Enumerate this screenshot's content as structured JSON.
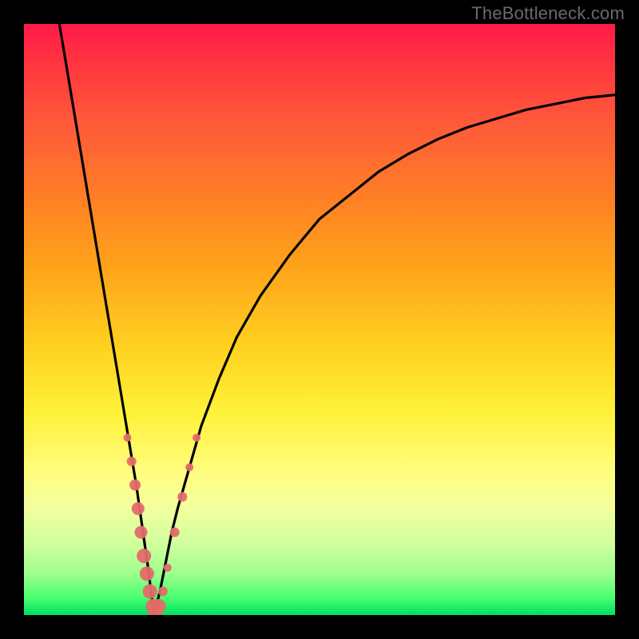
{
  "attribution": "TheBottleneck.com",
  "colors": {
    "frame": "#000000",
    "curve": "#000000",
    "markers": "#e46a6a",
    "gradient_top": "#ff1a4a",
    "gradient_bottom": "#00e060"
  },
  "chart_data": {
    "type": "line",
    "title": "",
    "xlabel": "",
    "ylabel": "",
    "xlim": [
      0,
      100
    ],
    "ylim": [
      0,
      100
    ],
    "grid": false,
    "legend": false,
    "note": "No axis tick labels are rendered; x and y are normalized 0–100. Curve is an absolute-value-like bottleneck function with a sharp minimum near x≈22.",
    "series": [
      {
        "name": "bottleneck-curve",
        "x": [
          6,
          8,
          10,
          12,
          14,
          16,
          18,
          19,
          20,
          21,
          22,
          23,
          24,
          25,
          26,
          28,
          30,
          33,
          36,
          40,
          45,
          50,
          55,
          60,
          65,
          70,
          75,
          80,
          85,
          90,
          95,
          100
        ],
        "y": [
          100,
          88,
          76,
          64,
          52,
          40,
          28,
          22,
          15,
          8,
          0,
          4,
          9,
          14,
          18,
          25,
          32,
          40,
          47,
          54,
          61,
          67,
          71,
          75,
          78,
          80.5,
          82.5,
          84,
          85.5,
          86.5,
          87.5,
          88
        ]
      }
    ],
    "markers": [
      {
        "x": 17.5,
        "y": 30,
        "r": 5
      },
      {
        "x": 18.2,
        "y": 26,
        "r": 6
      },
      {
        "x": 18.8,
        "y": 22,
        "r": 7
      },
      {
        "x": 19.3,
        "y": 18,
        "r": 8
      },
      {
        "x": 19.8,
        "y": 14,
        "r": 8
      },
      {
        "x": 20.3,
        "y": 10,
        "r": 9
      },
      {
        "x": 20.8,
        "y": 7,
        "r": 9
      },
      {
        "x": 21.3,
        "y": 4,
        "r": 9
      },
      {
        "x": 21.8,
        "y": 1.5,
        "r": 9
      },
      {
        "x": 22.2,
        "y": 0.5,
        "r": 9
      },
      {
        "x": 22.8,
        "y": 1.5,
        "r": 9
      },
      {
        "x": 23.5,
        "y": 4,
        "r": 6
      },
      {
        "x": 24.3,
        "y": 8,
        "r": 5
      },
      {
        "x": 25.5,
        "y": 14,
        "r": 6
      },
      {
        "x": 26.8,
        "y": 20,
        "r": 6
      },
      {
        "x": 28.0,
        "y": 25,
        "r": 5
      },
      {
        "x": 29.2,
        "y": 30,
        "r": 5
      }
    ]
  }
}
